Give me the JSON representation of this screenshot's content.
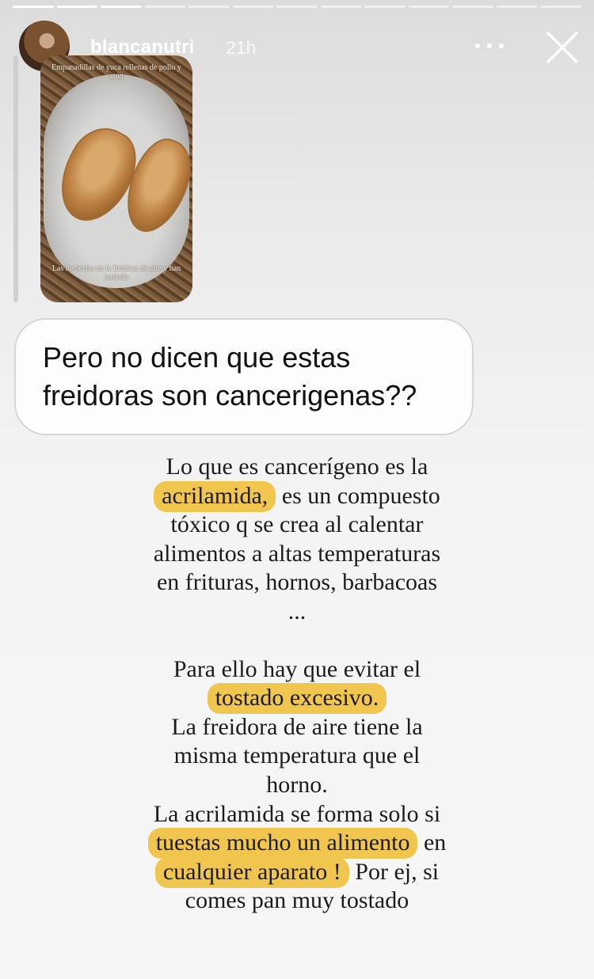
{
  "story": {
    "progress_total": 13,
    "progress_done": 3,
    "username": "blancanutri",
    "time_ago": "21h"
  },
  "icons": {
    "more": "more-horizontal-icon",
    "close": "close-icon"
  },
  "reply_thumbnail": {
    "caption_top": "Empanadillas de yuca rellenas de pollo y atún",
    "caption_bottom": "Las he hecho en la freidora de aire y han tardado"
  },
  "question": {
    "line1": "Pero no dicen que estas",
    "line2": "freidoras son cancerigenas??"
  },
  "answer": {
    "l1": "Lo que es cancerígeno es la",
    "l2_hl": "acrilamida,",
    "l2_rest": " es un compuesto",
    "l3": "tóxico q se crea al calentar",
    "l4": "alimentos a altas temperaturas",
    "l5": "en frituras, hornos, barbacoas",
    "l6": "...",
    "l7": "Para ello hay que evitar el",
    "l8_hl": "tostado excesivo.",
    "l9": "La freidora de aire tiene la",
    "l10": "misma temperatura que el",
    "l11": "horno.",
    "l12": "La acrilamida se forma solo si",
    "l13_hl": "tuestas mucho un alimento",
    "l13_rest": " en",
    "l14_hl": "cualquier aparato !",
    "l14_rest": " Por ej, si",
    "l15": "comes pan muy tostado"
  },
  "colors": {
    "highlight": "#f1c64e",
    "text": "#1c1c1c"
  }
}
